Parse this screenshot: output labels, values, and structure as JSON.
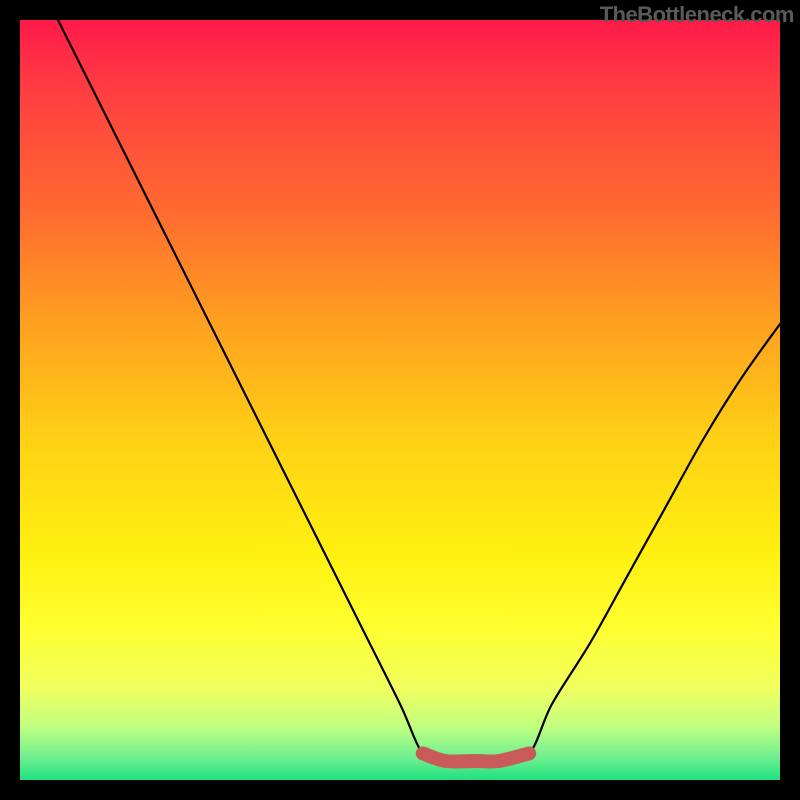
{
  "watermark": "TheBottleneck.com",
  "chart_data": {
    "type": "line",
    "title": "",
    "xlabel": "",
    "ylabel": "",
    "xlim": [
      0,
      100
    ],
    "ylim": [
      0,
      100
    ],
    "series": [
      {
        "name": "bottleneck-curve",
        "x": [
          5,
          10,
          15,
          20,
          25,
          30,
          35,
          40,
          45,
          50,
          53,
          56,
          60,
          63,
          67,
          70,
          75,
          80,
          85,
          90,
          95,
          100
        ],
        "values": [
          100,
          90,
          80,
          70,
          60,
          50,
          40,
          30,
          20,
          10,
          3.5,
          2.5,
          2.5,
          2.5,
          3.5,
          10,
          18,
          27,
          36,
          45,
          53,
          60
        ]
      },
      {
        "name": "flat-zone-marker",
        "x": [
          53,
          56,
          60,
          63,
          67
        ],
        "values": [
          3.5,
          2.5,
          2.5,
          2.5,
          3.5
        ]
      }
    ]
  }
}
